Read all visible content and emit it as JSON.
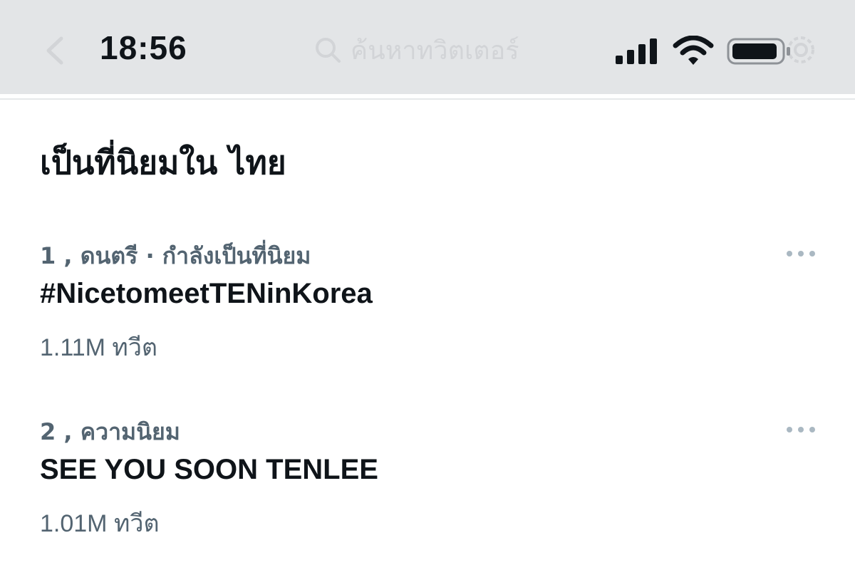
{
  "status_bar": {
    "time": "18:56",
    "icons": [
      "signal-icon",
      "wifi-icon",
      "battery-icon"
    ]
  },
  "header": {
    "search_placeholder": "ค้นหาทวิตเตอร์",
    "icons": [
      "back-icon",
      "search-icon",
      "settings-gear-icon"
    ]
  },
  "section": {
    "title": "เป็นที่นิยมใน ไทย"
  },
  "trends": [
    {
      "rank_meta": "1 , ดนตรี · กำลังเป็นที่นิยม",
      "name": "#NicetomeetTENinKorea",
      "count": "1.11M ทวีต"
    },
    {
      "rank_meta": "2 , ความนิยม",
      "name": "SEE YOU SOON TENLEE",
      "count": "1.01M ทวีต"
    }
  ],
  "colors": {
    "status_bar_bg": "#e3e5e7",
    "primary_text": "#0f1419",
    "secondary_text": "#536471",
    "more_dots": "#aab8c2"
  }
}
